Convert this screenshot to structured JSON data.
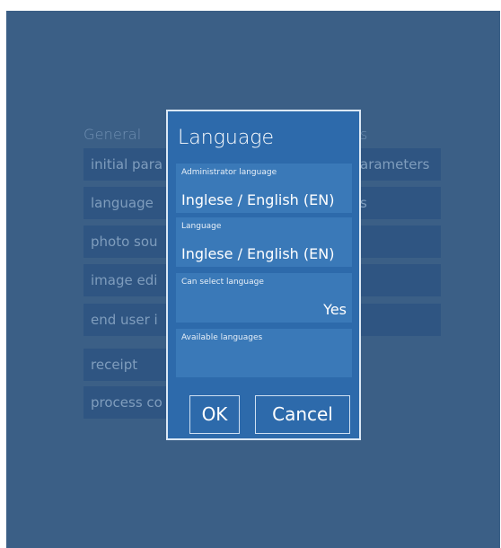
{
  "background": {
    "left_heading": "General",
    "right_heading": "s",
    "left_items": [
      "initial para",
      "language",
      "photo sou",
      "image edi",
      "end user i",
      "receipt",
      "process co"
    ],
    "right_items": [
      "arameters",
      "s",
      "",
      "",
      ""
    ]
  },
  "dialog": {
    "title": "Language",
    "fields": [
      {
        "label": "Administrator language",
        "value": "Inglese / English (EN)"
      },
      {
        "label": "Language",
        "value": "Inglese / English (EN)"
      },
      {
        "label": "Can select language",
        "value": "Yes"
      },
      {
        "label": "Available languages",
        "value": ""
      }
    ],
    "ok_label": "OK",
    "cancel_label": "Cancel"
  },
  "colors": {
    "screen_bg": "#3b5f86",
    "dialog_bg": "#2d6aab",
    "field_bg": "#3a79b8",
    "tile_bg": "#2f5582"
  }
}
